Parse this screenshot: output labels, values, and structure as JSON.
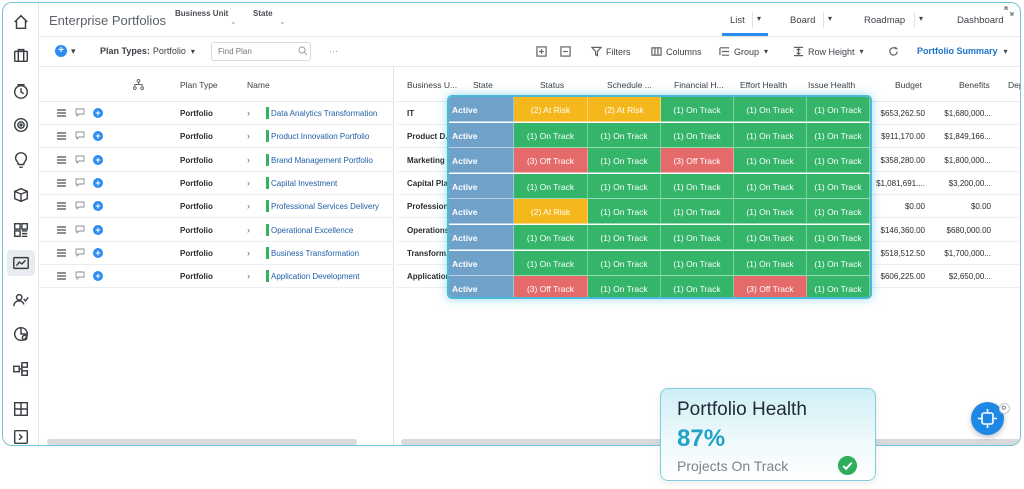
{
  "header": {
    "app_title": "Enterprise Portfolios",
    "filters": [
      {
        "label": "Business Unit"
      },
      {
        "label": "State"
      }
    ],
    "view_tabs": [
      {
        "label": "List",
        "active": true
      },
      {
        "label": "Board",
        "active": false
      },
      {
        "label": "Roadmap",
        "active": false
      },
      {
        "label": "Dashboard",
        "active": false
      }
    ]
  },
  "toolbar": {
    "plan_types_label": "Plan Types:",
    "plan_types_value": "Portfolio",
    "search_placeholder": "Find Plan",
    "more": "···",
    "filters": "Filters",
    "columns": "Columns",
    "group": "Group",
    "row_height": "Row Height",
    "summary": "Portfolio Summary"
  },
  "left_grid": {
    "columns": [
      "Plan Type",
      "Name"
    ],
    "rows": [
      {
        "plan_type": "Portfolio",
        "name": "Data Analytics Transformation"
      },
      {
        "plan_type": "Portfolio",
        "name": "Product Innovation Portfolio"
      },
      {
        "plan_type": "Portfolio",
        "name": "Brand Management Portfolio"
      },
      {
        "plan_type": "Portfolio",
        "name": "Capital Investment"
      },
      {
        "plan_type": "Portfolio",
        "name": "Professional Services Delivery"
      },
      {
        "plan_type": "Portfolio",
        "name": "Operational Excellence"
      },
      {
        "plan_type": "Portfolio",
        "name": "Business Transformation"
      },
      {
        "plan_type": "Portfolio",
        "name": "Application Development"
      }
    ]
  },
  "right_grid": {
    "columns": [
      "Business U...",
      "State",
      "Status",
      "Schedule ...",
      "Financial H...",
      "Effort Health",
      "Issue Health",
      "Budget",
      "Benefits",
      "Dep"
    ],
    "rows": [
      {
        "business_unit": "IT",
        "state": "Active",
        "status": "(2) At Risk",
        "schedule": "(2) At Risk",
        "financial": "(1) On Track",
        "effort": "(1) On Track",
        "issue": "(1) On Track",
        "budget": "$653,262.50",
        "benefits": "$1,680,000..."
      },
      {
        "business_unit": "Product D...",
        "state": "Active",
        "status": "(1) On Track",
        "schedule": "(1) On Track",
        "financial": "(1) On Track",
        "effort": "(1) On Track",
        "issue": "(1) On Track",
        "budget": "$911,170.00",
        "benefits": "$1,849,166..."
      },
      {
        "business_unit": "Marketing",
        "state": "Active",
        "status": "(3) Off Track",
        "schedule": "(1) On Track",
        "financial": "(3) Off Track",
        "effort": "(1) On Track",
        "issue": "(1) On Track",
        "budget": "$358,280.00",
        "benefits": "$1,800,000..."
      },
      {
        "business_unit": "Capital Pla...",
        "state": "Active",
        "status": "(1) On Track",
        "schedule": "(1) On Track",
        "financial": "(1) On Track",
        "effort": "(1) On Track",
        "issue": "(1) On Track",
        "budget": "$1,081,691....",
        "benefits": "$3,200,00..."
      },
      {
        "business_unit": "Profession...",
        "state": "Active",
        "status": "(2) At Risk",
        "schedule": "(1) On Track",
        "financial": "(1) On Track",
        "effort": "(1) On Track",
        "issue": "(1) On Track",
        "budget": "$0.00",
        "benefits": "$0.00"
      },
      {
        "business_unit": "Operations",
        "state": "Active",
        "status": "(1) On Track",
        "schedule": "(1) On Track",
        "financial": "(1) On Track",
        "effort": "(1) On Track",
        "issue": "(1) On Track",
        "budget": "$146,360.00",
        "benefits": "$680,000.00"
      },
      {
        "business_unit": "Transform...",
        "state": "Active",
        "status": "(1) On Track",
        "schedule": "(1) On Track",
        "financial": "(1) On Track",
        "effort": "(1) On Track",
        "issue": "(1) On Track",
        "budget": "$518,512.50",
        "benefits": "$1,700,000..."
      },
      {
        "business_unit": "Application",
        "state": "Active",
        "status": "(3) Off Track",
        "schedule": "(1) On Track",
        "financial": "(1) On Track",
        "effort": "(3) Off Track",
        "issue": "(1) On Track",
        "budget": "$606,225.00",
        "benefits": "$2,650,00..."
      }
    ]
  },
  "health_card": {
    "title": "Portfolio Health",
    "value": "87%",
    "subtitle": "Projects On Track"
  },
  "colors": {
    "on_track": "#34b56a",
    "at_risk": "#f5b81c",
    "off_track": "#e56b6b",
    "state_active": "#6fa1c9",
    "accent": "#2d8cf0",
    "brand": "#22a3c8"
  },
  "rail_icons": [
    "home-icon",
    "briefcase-icon",
    "history-icon",
    "target-icon",
    "lightbulb-icon",
    "box-icon",
    "grid-icon",
    "report-icon",
    "users-icon",
    "analytics-icon",
    "org-icon",
    "layout-icon",
    "expand-icon"
  ]
}
